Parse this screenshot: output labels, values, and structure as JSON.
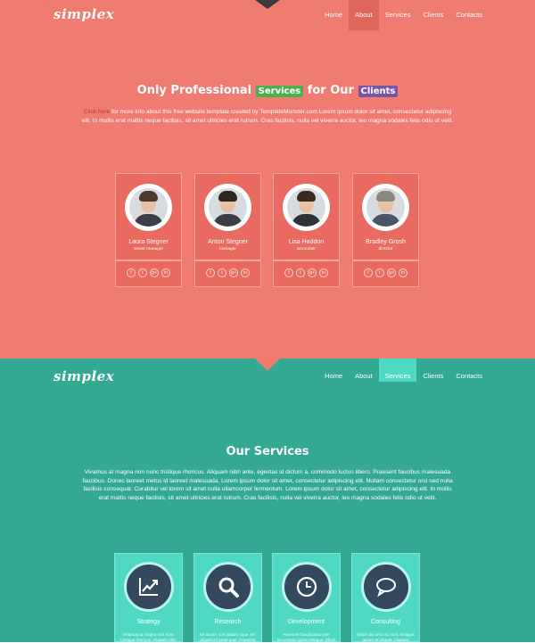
{
  "about": {
    "logo": "simplex",
    "menu": [
      "Home",
      "About",
      "Services",
      "Clients",
      "Contacts"
    ],
    "active_menu": "About",
    "heading": {
      "prefix": "Only Professional",
      "tag1": "Services",
      "middle": "for Our",
      "tag2": "Clients"
    },
    "intro_link": "Click here",
    "intro": " for more info about this free website template created by TemplateMonster.com Lorem ipsum dolor sit amet, consectetur adipiscing elit. In mollis erat mattis neque facilisis, sit amet ultricies erat rutrum. Cras facilisis, nulla vel viverra auctor, leo magna sodales felis odio ut velit.",
    "team": [
      {
        "name": "Laura Stegner",
        "role": "senior manager"
      },
      {
        "name": "Anton Stegner",
        "role": "manager"
      },
      {
        "name": "Lisa Haddon",
        "role": "accounter"
      },
      {
        "name": "Bradley Grosh",
        "role": "director"
      }
    ],
    "social": [
      "f",
      "t",
      "g+",
      "in"
    ]
  },
  "services": {
    "logo": "simplex",
    "menu": [
      "Home",
      "About",
      "Services",
      "Clients",
      "Contacts"
    ],
    "active_menu": "Services",
    "heading": "Our Services",
    "text": "Vivamus at magna non nunc tristique rhoncus. Aliquam nibh ante, egestas id dictum a, commodo luctus libero. Praesent faucibus malesuada faucibus. Donec laoreet metus id laoreet malesuada. Lorem ipsum dolor sit amet, consectetur adipiscing elit. Nullam consectetur orci sed nulla facilisis consequat. Curabitur vel lorem sit amet nulla ullamcorper fermentum. Lorem ipsum dolor sit amet, consectetur adipiscing elit. In mollis erat mattis neque facilisis, sit amet ultricies erat rutrum. Cras facilisis, nulla vel viverra auctor, leo magna sodales felis odio ut velit.",
    "items": [
      {
        "name": "Strategy",
        "icon": "chart-icon",
        "text": "Vivamus at magna non nunc tristique rhoncus. Aliquam nibh"
      },
      {
        "name": "Research",
        "icon": "search-icon",
        "text": "Ite auctor non jadiam oque vel, aliquet sit amet ante. Praesent"
      },
      {
        "name": "Development",
        "icon": "clock-icon",
        "text": "Praesent faucibusaru ater accumsam ignas tristique. Ellum"
      },
      {
        "name": "Consulting",
        "icon": "chat-icon",
        "text": "Etiam dui arcu ac nunc tristique ipsum sit aliquet. Aliquam"
      }
    ]
  },
  "colors": {
    "about_bg": "#f07b70",
    "services_bg": "#33a992",
    "services_card": "#4fd9c3",
    "icon_circle": "#34495e",
    "tag_green": "#4caf50",
    "tag_purple": "#7a55a5"
  }
}
